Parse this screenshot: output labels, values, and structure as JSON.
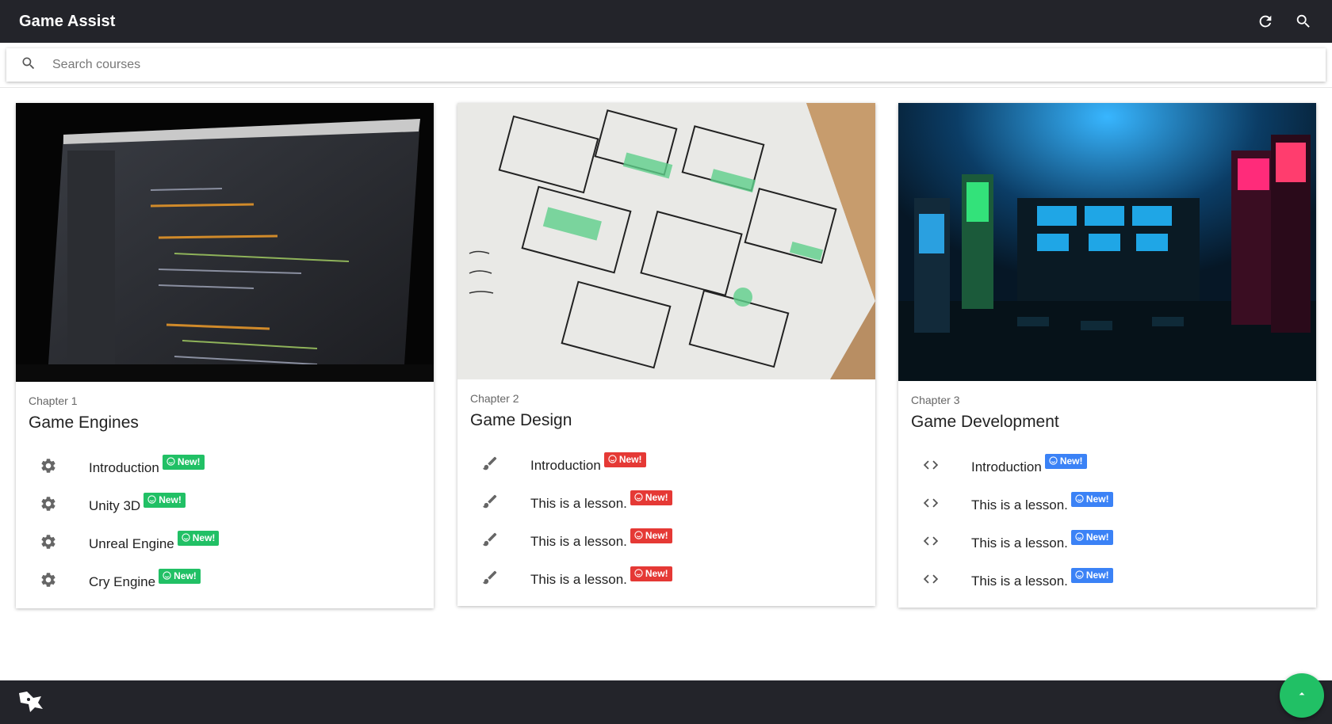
{
  "app": {
    "title": "Game Assist"
  },
  "search": {
    "placeholder": "Search courses"
  },
  "colors": {
    "green": "#21c065",
    "red": "#e53935",
    "blue": "#3b82f6",
    "bar": "#23242a"
  },
  "icons": {
    "refresh": "refresh-icon",
    "search": "search-icon",
    "up": "arrow-up-icon",
    "logo": "app-logo-icon"
  },
  "cards": [
    {
      "chapter": "Chapter 1",
      "title": "Game Engines",
      "image": "laptop-code-photo",
      "lesson_icon": "gear-icon",
      "badge_color": "#21c065",
      "lessons": [
        {
          "label": "Introduction",
          "badge": "New!"
        },
        {
          "label": "Unity 3D",
          "badge": "New!"
        },
        {
          "label": "Unreal Engine",
          "badge": "New!"
        },
        {
          "label": "Cry Engine",
          "badge": "New!"
        }
      ]
    },
    {
      "chapter": "Chapter 2",
      "title": "Game Design",
      "image": "wireframe-sketch-photo",
      "lesson_icon": "brush-icon",
      "badge_color": "#e53935",
      "lessons": [
        {
          "label": "Introduction",
          "badge": "New!"
        },
        {
          "label": "This is a lesson.",
          "badge": "New!"
        },
        {
          "label": "This is a lesson.",
          "badge": "New!"
        },
        {
          "label": "This is a lesson.",
          "badge": "New!"
        }
      ]
    },
    {
      "chapter": "Chapter 3",
      "title": "Game Development",
      "image": "arcade-room-photo",
      "lesson_icon": "code-icon",
      "badge_color": "#3b82f6",
      "lessons": [
        {
          "label": "Introduction",
          "badge": "New!"
        },
        {
          "label": "This is a lesson.",
          "badge": "New!"
        },
        {
          "label": "This is a lesson.",
          "badge": "New!"
        },
        {
          "label": "This is a lesson.",
          "badge": "New!"
        }
      ]
    }
  ]
}
